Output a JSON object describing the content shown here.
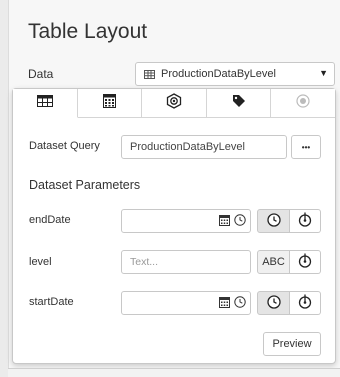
{
  "panel": {
    "title": "Table Layout",
    "data_label": "Data",
    "data_value": "ProductionDataByLevel"
  },
  "popup": {
    "tabs": [
      {
        "icon": "table-icon"
      },
      {
        "icon": "calculator-icon"
      },
      {
        "icon": "settings-hex-icon"
      },
      {
        "icon": "tag-icon"
      },
      {
        "icon": "radio-target-icon"
      }
    ],
    "dataset_query_label": "Dataset Query",
    "dataset_query_value": "ProductionDataByLevel",
    "more_label": "•••",
    "params_heading": "Dataset Parameters",
    "params": [
      {
        "name": "endDate",
        "type": "date",
        "value": ""
      },
      {
        "name": "level",
        "type": "text",
        "placeholder": "Text...",
        "type_label": "ABC"
      },
      {
        "name": "startDate",
        "type": "date",
        "value": ""
      }
    ],
    "preview_label": "Preview"
  },
  "colors": {
    "border": "#c8c8c8",
    "pressed": "#e4e4e4",
    "panel_bg": "#f7f7f7"
  }
}
